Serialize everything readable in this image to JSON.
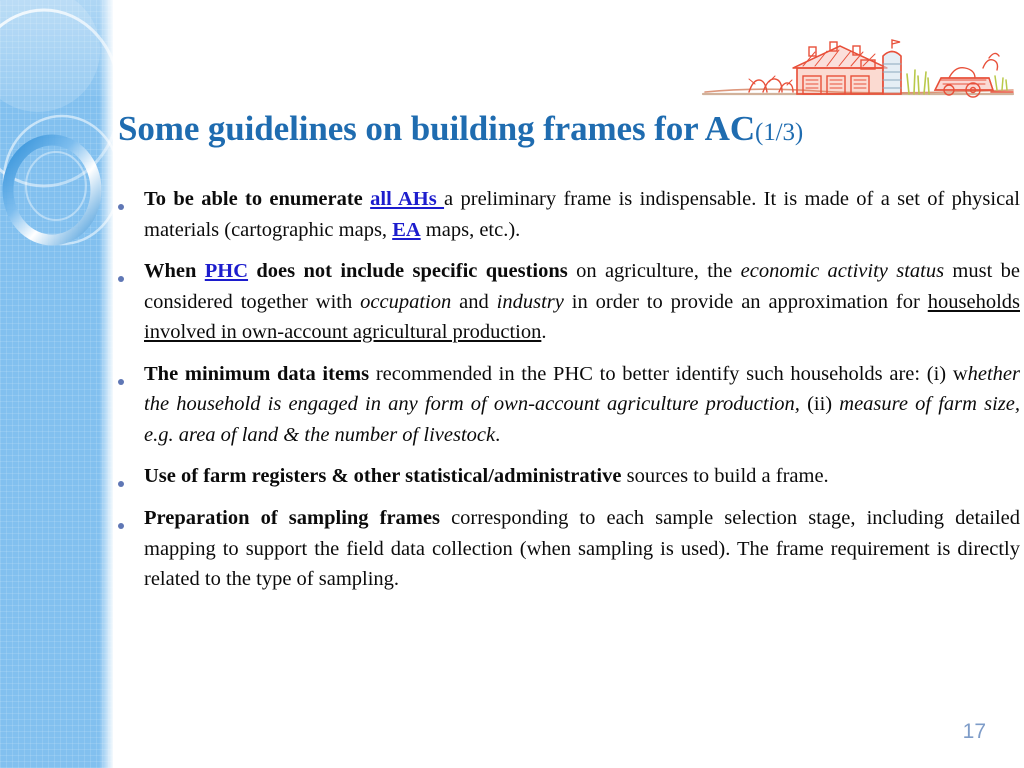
{
  "slide": {
    "title_main": "Some guidelines on building frames for AC",
    "title_suffix": "(1/3)",
    "page_number": "17",
    "accent_color": "#1f6cb0",
    "link_color": "#1c1ccd",
    "sidebar_color": "#82c0ef",
    "bullet_color": "#5f77b5",
    "page_number_color": "#7e9cc8",
    "farm_art_color": "#e8503a"
  },
  "decor": {
    "sidebar_name": "decorative-blue-band-with-rings",
    "farm_art_name": "farm-barn-silo-tractor-sketch"
  },
  "bullets": [
    {
      "id": "bullet-1",
      "align": "justify",
      "parts": [
        {
          "text": "To be able to enumerate ",
          "style": "bold"
        },
        {
          "text": "all AHs ",
          "style": "link"
        },
        {
          "text": "a preliminary frame is indispensable. It is made of a set of physical materials (cartographic maps, ",
          "style": "normal"
        },
        {
          "text": "EA",
          "style": "link"
        },
        {
          "text": " maps, etc.).",
          "style": "normal"
        }
      ]
    },
    {
      "id": "bullet-2",
      "align": "justify",
      "parts": [
        {
          "text": "When ",
          "style": "bold"
        },
        {
          "text": "PHC",
          "style": "link"
        },
        {
          "text": " does not include specific questions",
          "style": "bold"
        },
        {
          "text": " on agriculture, the ",
          "style": "normal"
        },
        {
          "text": "economic activity status",
          "style": "italic"
        },
        {
          "text": " must be considered together with ",
          "style": "normal"
        },
        {
          "text": "occupation",
          "style": "italic"
        },
        {
          "text": " and ",
          "style": "normal"
        },
        {
          "text": "industry",
          "style": "italic"
        },
        {
          "text": " in order to provide an approximation for ",
          "style": "normal"
        },
        {
          "text": "households involved in own-account agricultural production",
          "style": "underline"
        },
        {
          "text": ".",
          "style": "normal"
        }
      ]
    },
    {
      "id": "bullet-3",
      "align": "justify",
      "parts": [
        {
          "text": "The minimum data items",
          "style": "bold"
        },
        {
          "text": " recommended in the PHC to better identify such households are: (i) w",
          "style": "normal"
        },
        {
          "text": "hether the household is engaged in any form of own-account agriculture production,",
          "style": "italic"
        },
        {
          "text": " (ii) ",
          "style": "normal"
        },
        {
          "text": "measure of farm size, e.g. area of land & the number of livestock",
          "style": "italic"
        },
        {
          "text": ".",
          "style": "normal"
        }
      ]
    },
    {
      "id": "bullet-4",
      "align": "left",
      "parts": [
        {
          "text": "Use of farm registers & other statistical/administrative",
          "style": "bold"
        },
        {
          "text": " sources to build  a frame.",
          "style": "normal"
        }
      ]
    },
    {
      "id": "bullet-5",
      "align": "justify",
      "parts": [
        {
          "text": "Preparation of sampling frames",
          "style": "bold"
        },
        {
          "text": " corresponding to each sample selection stage, including detailed mapping to support the field data collection (when sampling is used). The frame requirement is directly related to the type of sampling.",
          "style": "normal"
        }
      ]
    }
  ]
}
